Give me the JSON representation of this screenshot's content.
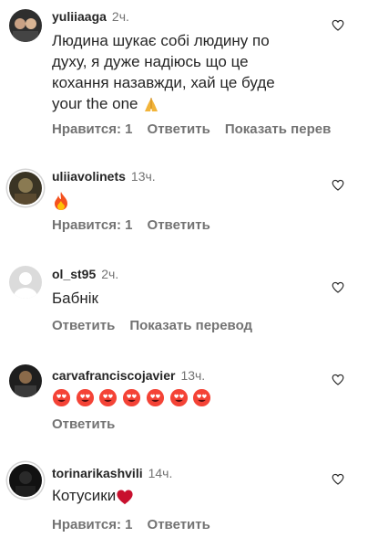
{
  "comments": [
    {
      "username": "yuliiaaga",
      "time": "2ч.",
      "text_lines": [
        "Людина шукає собі людину по",
        "духу, я дуже надіюсь що це",
        "кохання назавжди, хай це буде",
        "your the one"
      ],
      "emoji": "folded-hands",
      "likes_label": "Нравится: 1",
      "reply_label": "Ответить",
      "translate_label": "Показать перев",
      "avatar_colors": [
        "#3a3a3a",
        "#c9a184"
      ]
    },
    {
      "username": "uliiavolinets",
      "time": "13ч.",
      "emoji": "fire",
      "likes_label": "Нравится: 1",
      "reply_label": "Ответить",
      "avatar_colors": [
        "#6a5a3a",
        "#2c2820"
      ]
    },
    {
      "username": "ol_st95",
      "time": "2ч.",
      "text": "Бабнік",
      "reply_label": "Ответить",
      "translate_label": "Показать перевод",
      "avatar_colors": [
        "#dbdbdb",
        "#ffffff"
      ]
    },
    {
      "username": "carvafranciscojavier",
      "time": "13ч.",
      "emoji": "heart-eyes",
      "emoji_count": 7,
      "reply_label": "Ответить",
      "avatar_colors": [
        "#1e1e1e",
        "#8a6a4a"
      ]
    },
    {
      "username": "torinarikashvili",
      "time": "14ч.",
      "text": "Котусики",
      "emoji": "red-heart",
      "likes_label": "Нравится: 1",
      "reply_label": "Ответить",
      "avatar_colors": [
        "#111111",
        "#2a2a2a"
      ]
    }
  ]
}
